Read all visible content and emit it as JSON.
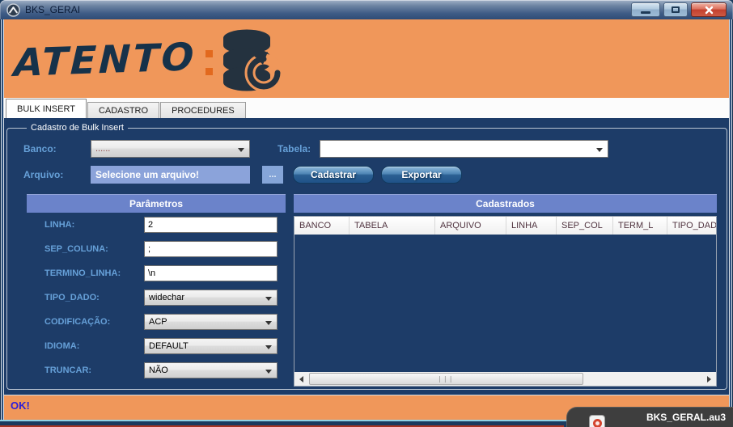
{
  "window": {
    "title": "BKS_GERAI"
  },
  "header": {
    "logo_text": "ATENTO"
  },
  "tabs": [
    {
      "label": "BULK INSERT",
      "active": true
    },
    {
      "label": "CADASTRO",
      "active": false
    },
    {
      "label": "PROCEDURES",
      "active": false
    }
  ],
  "bulk_insert": {
    "groupbox_title": "Cadastro de Bulk Insert",
    "banco": {
      "label": "Banco:",
      "value": "......"
    },
    "tabela": {
      "label": "Tabela:",
      "value": ""
    },
    "arquivo": {
      "label": "Arquivo:",
      "value": "Selecione um arquivo!",
      "browse_label": "..."
    },
    "buttons": {
      "cadastrar": "Cadastrar",
      "exportar": "Exportar"
    },
    "parametros": {
      "title": "Parâmetros",
      "fields": [
        {
          "label": "LINHA:",
          "value": "2",
          "type": "input"
        },
        {
          "label": "SEP_COLUNA:",
          "value": ";",
          "type": "input"
        },
        {
          "label": "TERMINO_LINHA:",
          "value": "\\n",
          "type": "input"
        },
        {
          "label": "TIPO_DADO:",
          "value": "widechar",
          "type": "select"
        },
        {
          "label": "CODIFICAÇÃO:",
          "value": "ACP",
          "type": "select"
        },
        {
          "label": "IDIOMA:",
          "value": "DEFAULT",
          "type": "select"
        },
        {
          "label": "TRUNCAR:",
          "value": "NÃO",
          "type": "select"
        }
      ]
    },
    "cadastrados": {
      "title": "Cadastrados",
      "columns": [
        "BANCO",
        "TABELA",
        "ARQUIVO",
        "LINHA",
        "SEP_COL",
        "TERM_L",
        "TIPO_DADO"
      ],
      "rows": []
    }
  },
  "statusbar": {
    "text": "OK!"
  },
  "tray_tooltip": {
    "text": "BKS_GERAL.au3"
  },
  "colors": {
    "orange": "#F0975A",
    "navy": "#1D3C68",
    "periwinkle": "#6B83CA",
    "labelblue": "#66A0D8",
    "statusblue": "#2B1FD9"
  }
}
